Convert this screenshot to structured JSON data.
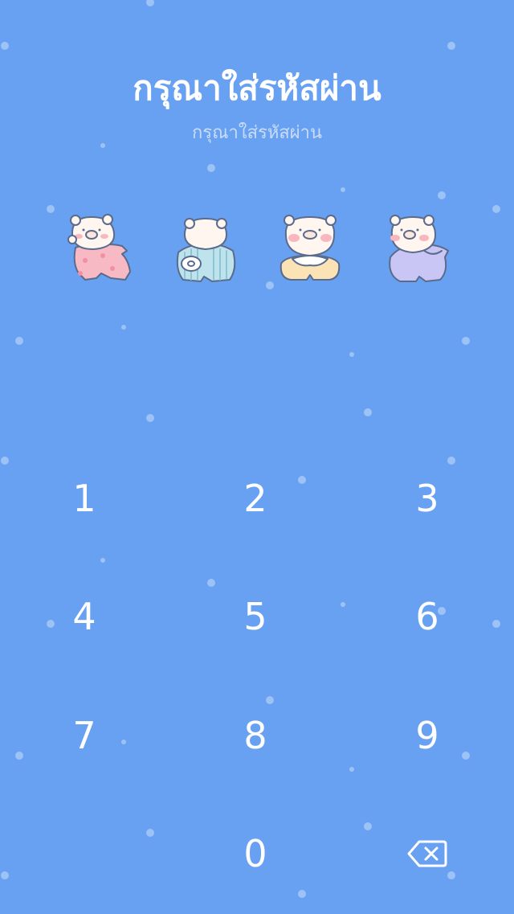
{
  "header": {
    "title": "กรุณาใส่รหัสผ่าน",
    "subtitle": "กรุณาใส่รหัสผ่าน"
  },
  "passcode": {
    "slots": [
      {
        "icon": "bear-pink-pajamas-icon",
        "color": "#f7b9c4"
      },
      {
        "icon": "bear-blue-striped-icon",
        "color": "#bfe3ec"
      },
      {
        "icon": "bear-cream-icon",
        "color": "#fbe3b6"
      },
      {
        "icon": "bear-lavender-icon",
        "color": "#c9c6f5"
      }
    ]
  },
  "keypad": {
    "keys": [
      "1",
      "2",
      "3",
      "4",
      "5",
      "6",
      "7",
      "8",
      "9",
      "0"
    ],
    "backspace_icon": "backspace-icon"
  },
  "colors": {
    "background": "#68a1f1",
    "text": "#ffffff",
    "subtitle": "#c8dcf8"
  }
}
